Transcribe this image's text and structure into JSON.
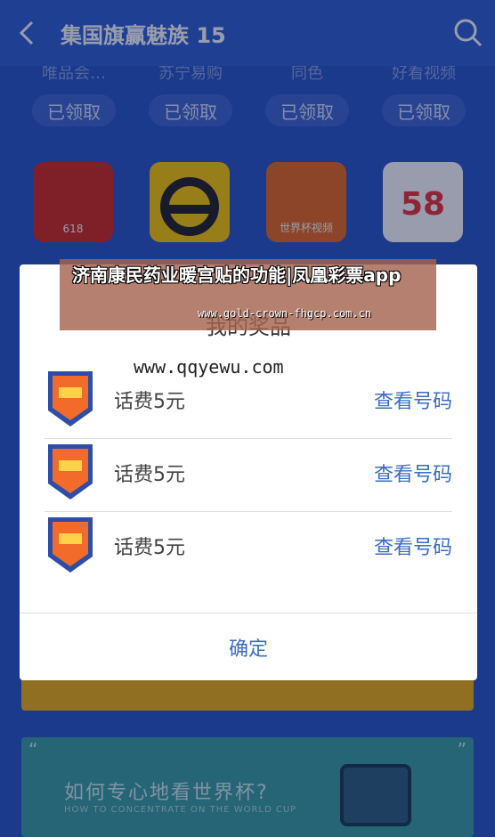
{
  "topbar": {
    "title": "集国旗赢魅族 15",
    "back_icon": "chevron-left-icon",
    "search_icon": "search-icon"
  },
  "background": {
    "app_labels": [
      "唯品会…",
      "苏宁易购",
      "同色",
      "好看视频"
    ],
    "claimed_labels": [
      "已领取",
      "已领取",
      "已领取",
      "已领取"
    ],
    "app_icon_texts": [
      "618",
      "",
      "世界杯视频",
      "58"
    ],
    "banner": {
      "title": "如何专心地看世界杯?",
      "subtitle": "HOW TO CONCENTRATE ON THE WORLD CUP",
      "quote_open": "“",
      "quote_close": "”"
    }
  },
  "dialog": {
    "title": "我的奖品",
    "watermark": "www.qqyewu.com",
    "prizes": [
      {
        "name": "话费5元",
        "action": "查看号码"
      },
      {
        "name": "话费5元",
        "action": "查看号码"
      },
      {
        "name": "话费5元",
        "action": "查看号码"
      }
    ],
    "confirm_label": "确定"
  },
  "promo": {
    "text": "济南康民药业暖宫贴的功能|凤凰彩票app",
    "url": "www.gold-crown-fhgcp.com.cn"
  },
  "colors": {
    "topbar": "#2f5fd0",
    "accent_link": "#3b6cc4",
    "badge_orange": "#f26b2a",
    "badge_blue": "#2d4da8"
  }
}
